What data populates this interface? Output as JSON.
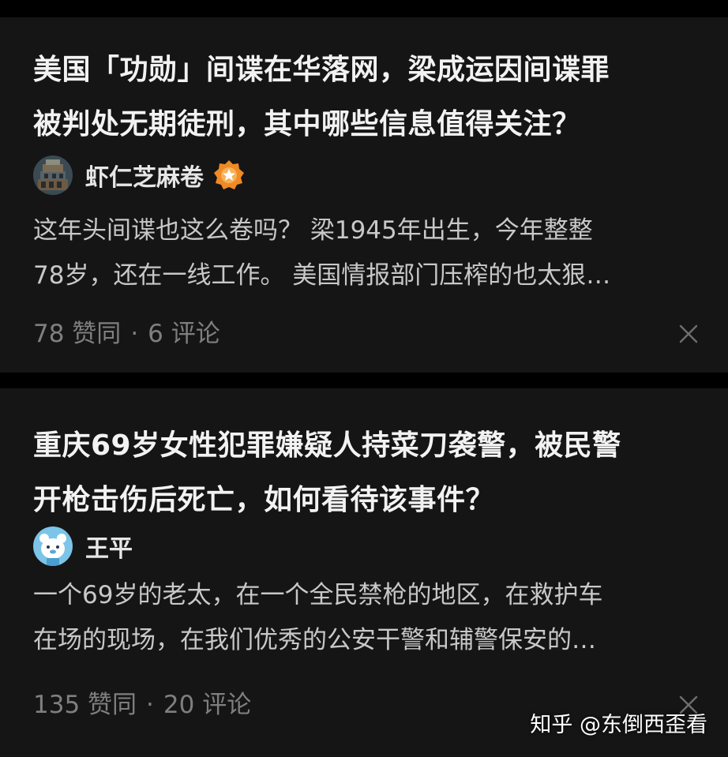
{
  "feed": {
    "cards": [
      {
        "title_lines": [
          "美国「功勋」间谍在华落网，梁成运因间谍罪",
          "被判处无期徒刑，其中哪些信息值得关注？"
        ],
        "author": {
          "name": "虾仁芝麻卷",
          "avatar_icon": "bookshelf-avatar-icon",
          "badge_icon": "verified-badge-icon"
        },
        "excerpt_lines": [
          "这年头间谍也这么卷吗？ 梁1945年出生，今年整整",
          "78岁，还在一线工作。 美国情报部门压榨的也太狠…"
        ],
        "upvotes": "78 赞同",
        "separator": "·",
        "comments": "6 评论",
        "dismiss_icon": "close-icon"
      },
      {
        "title_lines": [
          "重庆69岁女性犯罪嫌疑人持菜刀袭警，被民警",
          "开枪击伤后死亡，如何看待该事件？"
        ],
        "author": {
          "name": "王平",
          "avatar_icon": "cartoon-bear-avatar-icon"
        },
        "excerpt_lines": [
          "一个69岁的老太，在一个全民禁枪的地区，在救护车",
          "在场的现场，在我们优秀的公安干警和辅警保安的…"
        ],
        "upvotes": "135 赞同",
        "separator": "·",
        "comments": "20 评论",
        "dismiss_icon": "close-icon"
      }
    ]
  },
  "watermark": "知乎 @东倒西歪看",
  "colors": {
    "background": "#000000",
    "card": "#151515",
    "title": "#f2f2f2",
    "excerpt": "#c8c8c8",
    "meta": "#7f7f7f",
    "badge": "#f08a24"
  }
}
